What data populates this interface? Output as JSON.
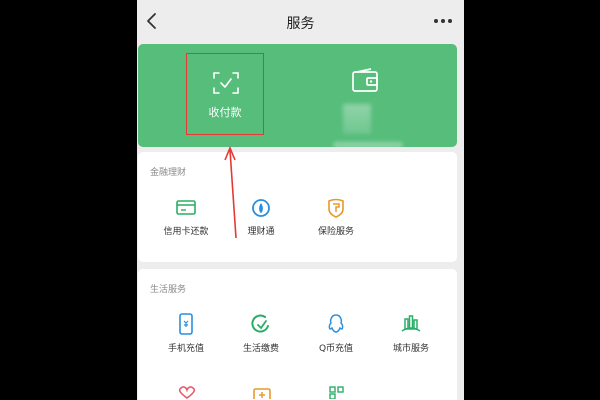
{
  "header": {
    "title": "服务",
    "back_icon": "chevron-left-icon",
    "more_icon": "more-dots-icon"
  },
  "top_card": {
    "pay": {
      "label": "收付款",
      "icon": "scan-check-icon"
    },
    "wallet": {
      "icon": "wallet-icon"
    },
    "background_color": "#56bd7b",
    "highlight_color": "#e53935"
  },
  "finance": {
    "title": "金融理财",
    "items": [
      {
        "label": "信用卡还款",
        "icon": "credit-card-icon"
      },
      {
        "label": "理财通",
        "icon": "licaitong-icon"
      },
      {
        "label": "保险服务",
        "icon": "insurance-icon"
      }
    ]
  },
  "life": {
    "title": "生活服务",
    "items": [
      {
        "label": "手机充值",
        "icon": "phone-recharge-icon"
      },
      {
        "label": "生活缴费",
        "icon": "utility-payment-icon"
      },
      {
        "label": "Q币充值",
        "icon": "qcoin-icon"
      },
      {
        "label": "城市服务",
        "icon": "city-service-icon"
      }
    ]
  }
}
